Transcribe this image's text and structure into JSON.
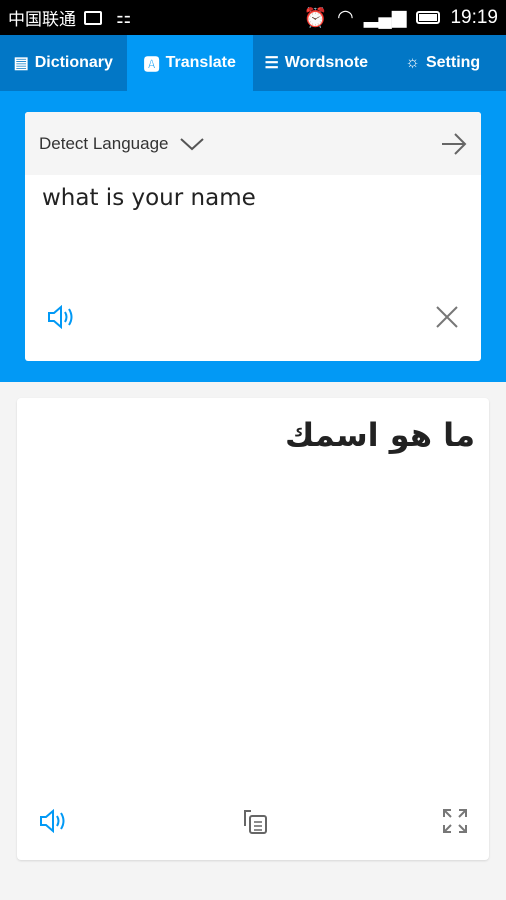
{
  "status": {
    "carrier": "中国联通",
    "time": "19:19"
  },
  "tabs": [
    {
      "label": "Dictionary",
      "icon": "book-icon"
    },
    {
      "label": "Translate",
      "icon": "translate-icon",
      "active": true
    },
    {
      "label": "Wordsnote",
      "icon": "notepad-icon"
    },
    {
      "label": "Setting",
      "icon": "gear-icon"
    }
  ],
  "source": {
    "language": "Detect Language",
    "text": "what is your name"
  },
  "result": {
    "text": "ما هو اسمك"
  },
  "colors": {
    "accent": "#0299f5",
    "tabbar": "#0277c6"
  }
}
